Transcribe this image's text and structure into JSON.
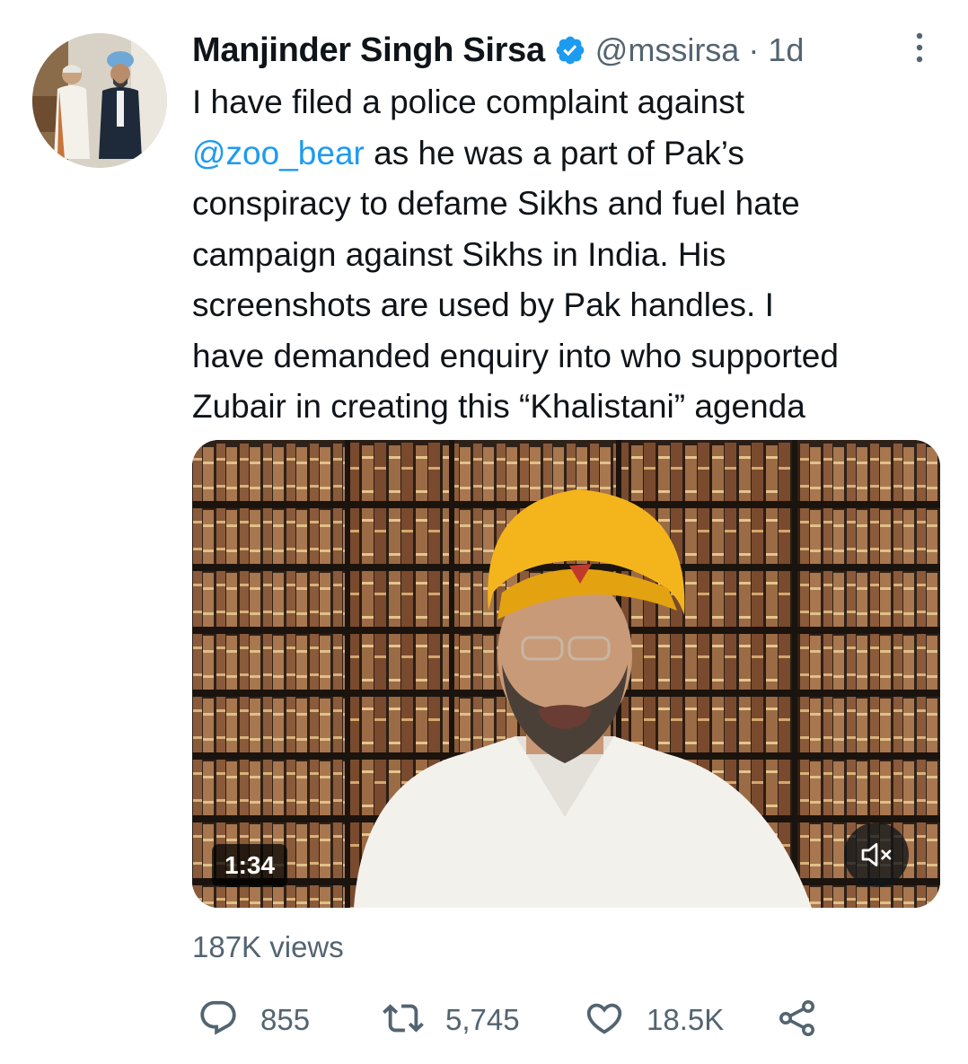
{
  "author": {
    "display_name": "Manjinder Singh Sirsa",
    "handle": "@mssirsa",
    "separator": "·",
    "time": "1d",
    "verified_color": "#1d9bf0"
  },
  "tweet": {
    "lines": [
      {
        "text": "I have filed a police complaint against"
      },
      {
        "mention": "@zoo_bear",
        "text": " as he was a part of Pak’s"
      },
      {
        "text": "conspiracy to defame Sikhs and fuel hate"
      },
      {
        "text": "campaign against Sikhs in India. His"
      },
      {
        "text": "screenshots are used by Pak handles. I"
      },
      {
        "text": "have demanded enquiry into who supported"
      },
      {
        "text": "Zubair in creating this “Khalistani” agenda"
      }
    ],
    "mention_color": "#1d9bf0"
  },
  "media": {
    "duration": "1:34",
    "mute_icon": "volume-muted-icon"
  },
  "stats": {
    "views": "187K views"
  },
  "actions": {
    "reply_count": "855",
    "retweet_count": "5,745",
    "like_count": "18.5K",
    "icons": [
      "reply-icon",
      "retweet-icon",
      "like-icon",
      "share-icon"
    ]
  },
  "colors": {
    "text": "#0f1419",
    "secondary": "#536471",
    "accent": "#1d9bf0"
  }
}
